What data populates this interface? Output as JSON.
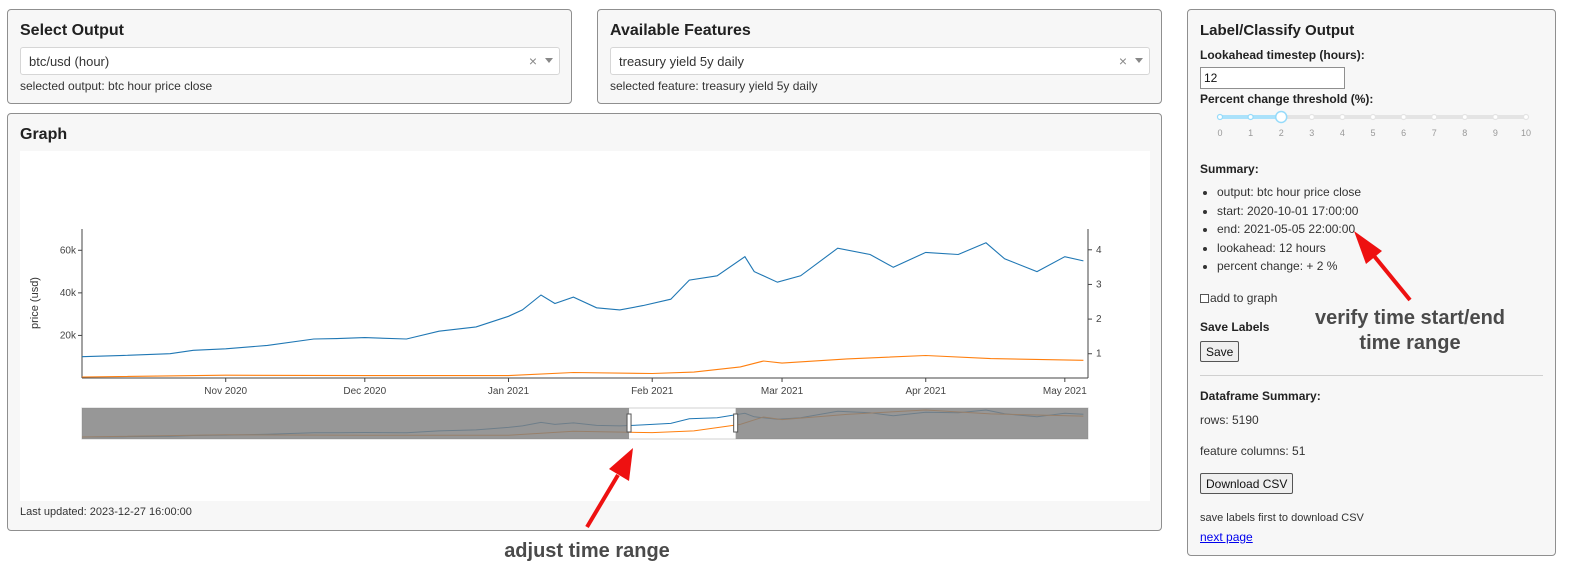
{
  "select_output": {
    "title": "Select Output",
    "value": "btc/usd (hour)",
    "caption": "selected output: btc hour price close"
  },
  "features": {
    "title": "Available Features",
    "value": "treasury yield 5y daily",
    "caption": "selected feature: treasury yield 5y daily"
  },
  "graph": {
    "title": "Graph",
    "last_updated": "Last updated: 2023-12-27 16:00:00"
  },
  "chart_data": {
    "type": "line",
    "ylabel": "price (usd)",
    "y_ticks": [
      "20k",
      "40k",
      "60k"
    ],
    "y2_ticks": [
      "1",
      "2",
      "3",
      "4"
    ],
    "x_ticks": [
      "Nov 2020",
      "Dec 2020",
      "Jan 2021",
      "Feb 2021",
      "Mar 2021",
      "Apr 2021",
      "May 2021"
    ],
    "ylim": [
      0,
      70000
    ],
    "y2lim": [
      0.3,
      4.6
    ],
    "xlim": [
      "2020-10-01",
      "2021-05-06"
    ],
    "series": [
      {
        "color": "#1f77b4",
        "axis": "left",
        "x": [
          "2020-10-01",
          "2020-10-10",
          "2020-10-20",
          "2020-10-25",
          "2020-11-01",
          "2020-11-10",
          "2020-11-20",
          "2020-11-25",
          "2020-12-01",
          "2020-12-10",
          "2020-12-17",
          "2020-12-25",
          "2021-01-01",
          "2021-01-04",
          "2021-01-08",
          "2021-01-11",
          "2021-01-15",
          "2021-01-20",
          "2021-01-25",
          "2021-01-30",
          "2021-02-05",
          "2021-02-09",
          "2021-02-15",
          "2021-02-21",
          "2021-02-23",
          "2021-02-28",
          "2021-03-05",
          "2021-03-13",
          "2021-03-20",
          "2021-03-25",
          "2021-04-01",
          "2021-04-08",
          "2021-04-14",
          "2021-04-18",
          "2021-04-25",
          "2021-05-01",
          "2021-05-05"
        ],
        "y": [
          10000,
          10600,
          11400,
          13000,
          13700,
          15300,
          18300,
          18500,
          19000,
          18300,
          22000,
          24000,
          29000,
          32000,
          39000,
          35000,
          38000,
          33000,
          32000,
          34000,
          37000,
          46000,
          48000,
          57000,
          50000,
          45000,
          48000,
          61000,
          58000,
          52000,
          59000,
          58000,
          63500,
          56000,
          50000,
          57000,
          55000
        ]
      },
      {
        "color": "#ff7f0e",
        "axis": "right",
        "x": [
          "2020-10-01",
          "2020-11-01",
          "2020-12-01",
          "2021-01-01",
          "2021-01-15",
          "2021-02-01",
          "2021-02-10",
          "2021-02-20",
          "2021-02-25",
          "2021-03-01",
          "2021-03-15",
          "2021-04-01",
          "2021-04-15",
          "2021-05-05"
        ],
        "y": [
          0.33,
          0.38,
          0.37,
          0.37,
          0.46,
          0.43,
          0.47,
          0.62,
          0.79,
          0.73,
          0.85,
          0.95,
          0.86,
          0.81
        ]
      }
    ],
    "range_slider": {
      "selected_start": "2021-01-27",
      "selected_end": "2021-02-19"
    }
  },
  "label_panel": {
    "title": "Label/Classify Output",
    "lookahead_label": "Lookahead timestep (hours):",
    "lookahead_value": "12",
    "threshold_label": "Percent change threshold (%):",
    "slider_ticks": [
      "0",
      "1",
      "2",
      "3",
      "4",
      "5",
      "6",
      "7",
      "8",
      "9",
      "10"
    ],
    "slider_value": 2,
    "slider_min": 0,
    "slider_max": 10,
    "summary_label": "Summary:",
    "summary_items": [
      "output: btc hour price close",
      "start: 2020-10-01 17:00:00",
      "end: 2021-05-05 22:00:00",
      "lookahead: 12 hours",
      "percent change: + 2 %"
    ],
    "add_to_graph": "add to graph",
    "save_labels_label": "Save Labels",
    "save_button": "Save",
    "df_summary_label": "Dataframe Summary:",
    "rows": "rows: 5190",
    "feature_columns": "feature columns: 51",
    "download_button": "Download CSV",
    "download_note": "save labels first to download CSV",
    "next_link": "next page"
  },
  "annotations": {
    "verify_line1": "verify time start/end",
    "verify_line2": "time range",
    "adjust": "adjust time range",
    "arrow_color": "#ee1111"
  }
}
